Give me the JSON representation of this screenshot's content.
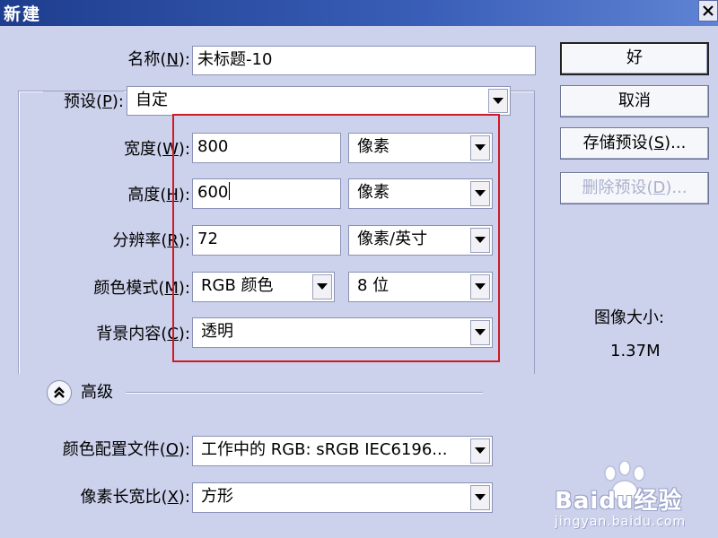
{
  "dialog": {
    "title": "新建"
  },
  "form": {
    "name": {
      "label": "名称(",
      "key": "N",
      "label_end": "):",
      "value": "未标题-10"
    },
    "preset": {
      "label": "预设(",
      "key": "P",
      "label_end": "):",
      "value": "自定"
    },
    "width": {
      "label": "宽度(",
      "key": "W",
      "label_end": "):",
      "value": "800",
      "unit": "像素"
    },
    "height": {
      "label": "高度(",
      "key": "H",
      "label_end": "):",
      "value": "600",
      "unit": "像素"
    },
    "resolution": {
      "label": "分辨率(",
      "key": "R",
      "label_end": "):",
      "value": "72",
      "unit": "像素/英寸"
    },
    "color_mode": {
      "label": "颜色模式(",
      "key": "M",
      "label_end": "):",
      "value": "RGB 颜色",
      "depth": "8 位"
    },
    "background": {
      "label": "背景内容(",
      "key": "C",
      "label_end": "):",
      "value": "透明"
    },
    "advanced": {
      "label": "高级"
    },
    "color_profile": {
      "label": "颜色配置文件(",
      "key": "O",
      "label_end": "):",
      "value": "工作中的 RGB: sRGB IEC6196..."
    },
    "pixel_aspect": {
      "label": "像素长宽比(",
      "key": "X",
      "label_end": "):",
      "value": "方形"
    }
  },
  "buttons": {
    "ok": "好",
    "cancel": "取消",
    "save_preset": {
      "text": "存储预设(",
      "key": "S",
      "end": ")..."
    },
    "delete_preset": {
      "text": "删除预设(",
      "key": "D",
      "end": ")..."
    }
  },
  "image_size": {
    "label": "图像大小:",
    "value": "1.37M"
  },
  "watermark": {
    "brand": "Baidu经验",
    "url": "jingyan.baidu.com"
  },
  "colors": {
    "dialog_bg": "#ccd1ec",
    "titlebar": "#1e3d8e",
    "highlight_box": "#d11a22"
  }
}
